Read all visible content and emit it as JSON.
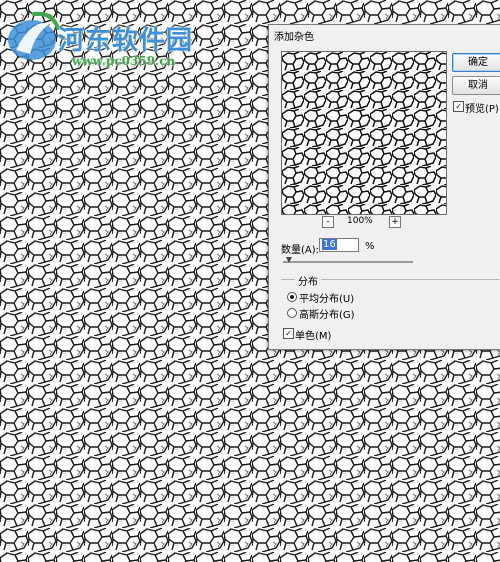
{
  "watermark": {
    "title": "河东软件园",
    "url": "www.pc0359.cn",
    "title_color": "#3d8fd8",
    "url_color": "#3fa84a"
  },
  "dialog": {
    "title": "添加杂色",
    "ok_label": "确定",
    "cancel_label": "取消",
    "preview_checkbox": {
      "label": "预览(P)",
      "checked": true
    },
    "zoom": {
      "minus_label": "-",
      "plus_label": "+",
      "level": "100%"
    },
    "amount": {
      "label": "数量(A):",
      "value": "16",
      "unit": "%"
    },
    "distribution": {
      "title": "分布",
      "options": [
        {
          "label": "平均分布(U)",
          "selected": true
        },
        {
          "label": "高斯分布(G)",
          "selected": false
        }
      ]
    },
    "monochromatic": {
      "label": "单色(M)",
      "checked": true
    }
  },
  "colors": {
    "accent": "#3874d8",
    "dialog_bg": "#f0f0f0",
    "pattern_line": "#1a1a1a"
  },
  "icons": {
    "logo": "hedong-logo-icon",
    "check": "check-icon",
    "zoom_in": "zoom-in-icon",
    "zoom_out": "zoom-out-icon"
  }
}
